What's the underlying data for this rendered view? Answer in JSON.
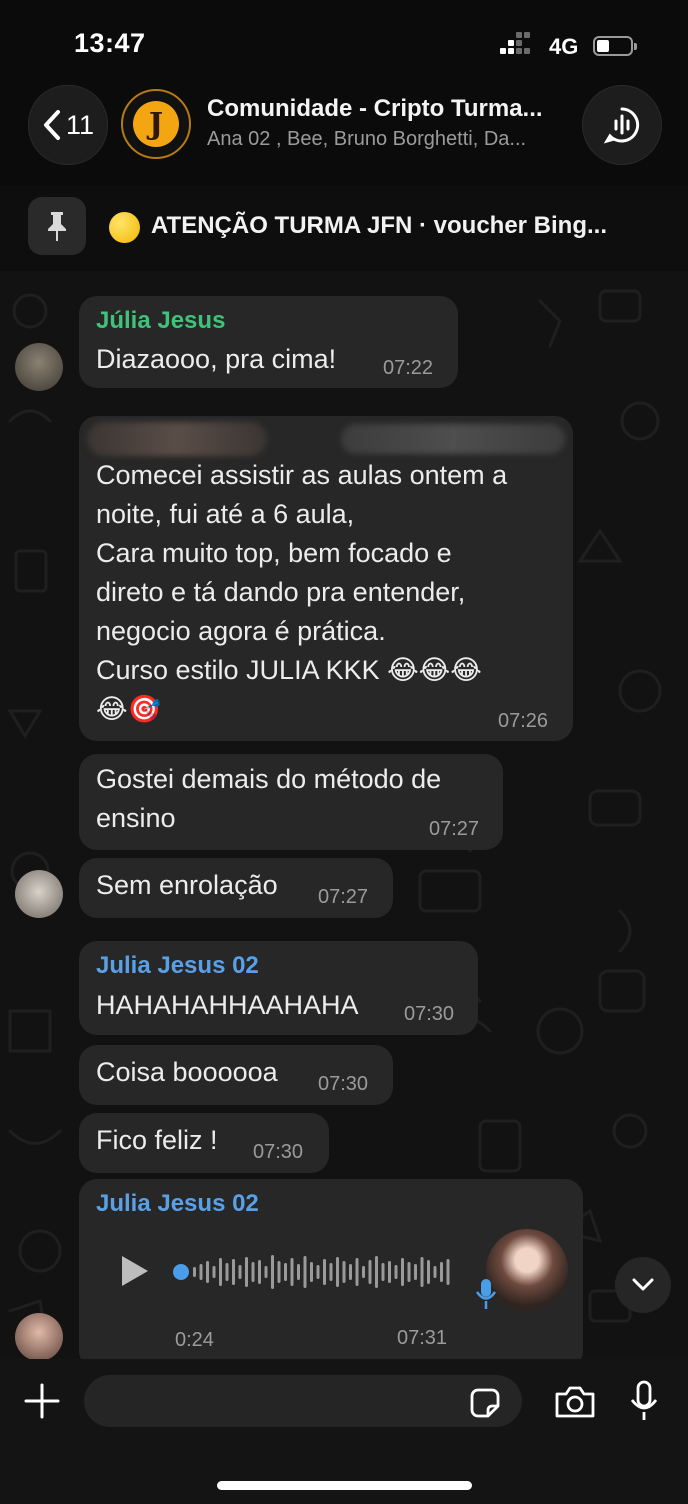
{
  "status_bar": {
    "time": "13:47",
    "network": "4G"
  },
  "header": {
    "back_count": "11",
    "title": "Comunidade - Cripto Turma...",
    "members": "Ana 02 , Bee, Bruno Borghetti, Da...",
    "avatar_letter": "J"
  },
  "pinned": {
    "text": "ATENÇÃO TURMA JFN · voucher Bing..."
  },
  "messages": [
    {
      "sender": "Júlia Jesus",
      "text": "Diazaooo, pra cima!",
      "time": "07:22"
    },
    {
      "lines": [
        "Comecei assistir as aulas ontem a",
        "noite, fui até a 6 aula,",
        "Cara muito top, bem focado e",
        "direto e tá dando pra entender,",
        "negocio agora é prática.",
        "Curso estilo JULIA KKK 😂😂😂",
        "😂🎯"
      ],
      "time": "07:26"
    },
    {
      "lines": [
        "Gostei demais do método de",
        "ensino"
      ],
      "time": "07:27"
    },
    {
      "text": "Sem enrolação",
      "time": "07:27"
    },
    {
      "sender": "Julia Jesus 02",
      "text": "HAHAHAHHAAHAHA",
      "time": "07:30"
    },
    {
      "text": "Coisa boooooa",
      "time": "07:30"
    },
    {
      "text": "Fico feliz !",
      "time": "07:30"
    },
    {
      "sender": "Julia Jesus 02",
      "audio_duration": "0:24",
      "time": "07:31",
      "audio_progress": 0
    }
  ],
  "colors": {
    "sender_green": "#3fc27a",
    "sender_blue": "#5aa0e6",
    "bubble": "#272727"
  },
  "icons": [
    "back-chevron-icon",
    "voice-chat-icon",
    "pin-icon",
    "play-icon",
    "microphone-icon",
    "scroll-down-icon",
    "plus-icon",
    "sticker-icon",
    "camera-icon"
  ]
}
